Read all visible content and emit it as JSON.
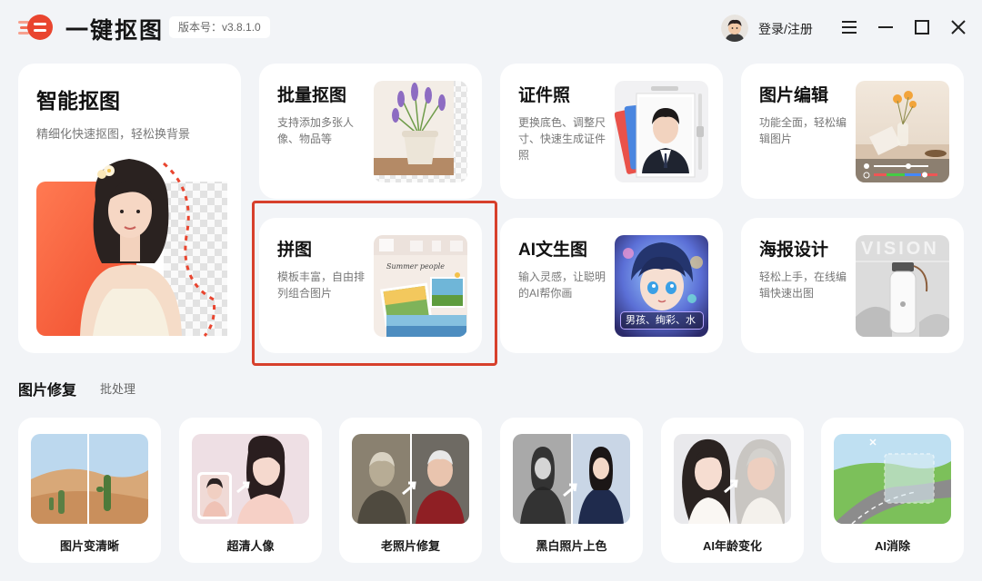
{
  "app": {
    "title": "一键抠图",
    "version": "版本号：v3.8.1.0",
    "login_label": "登录/注册",
    "accent": "#e9452f"
  },
  "window_controls": [
    "menu-icon",
    "minimize-icon",
    "maximize-icon",
    "close-icon"
  ],
  "feature_cards": {
    "smart": {
      "title": "智能抠图",
      "desc": "精细化快速抠图，轻松换背景"
    },
    "batch": {
      "title": "批量抠图",
      "desc": "支持添加多张人像、物品等"
    },
    "idphoto": {
      "title": "证件照",
      "desc": "更换底色、调整尺寸、快速生成证件照"
    },
    "edit": {
      "title": "图片编辑",
      "desc": "功能全面，轻松编辑图片"
    },
    "collage": {
      "title": "拼图",
      "desc": "模板丰富，自由排列组合图片",
      "thumb_script": "Summer people"
    },
    "ai_text": {
      "title": "AI文生图",
      "desc": "输入灵感，让聪明的AI帮你画",
      "prompt_chip": "男孩、绚彩、水"
    },
    "poster": {
      "title": "海报设计",
      "desc": "轻松上手，在线编辑快速出图",
      "thumb_text": "VISION"
    }
  },
  "repair_section": {
    "title": "图片修复",
    "batch_link": "批处理",
    "tools": [
      {
        "label": "图片变清晰"
      },
      {
        "label": "超清人像"
      },
      {
        "label": "老照片修复"
      },
      {
        "label": "黑白照片上色"
      },
      {
        "label": "AI年龄变化"
      },
      {
        "label": "AI消除"
      }
    ]
  }
}
